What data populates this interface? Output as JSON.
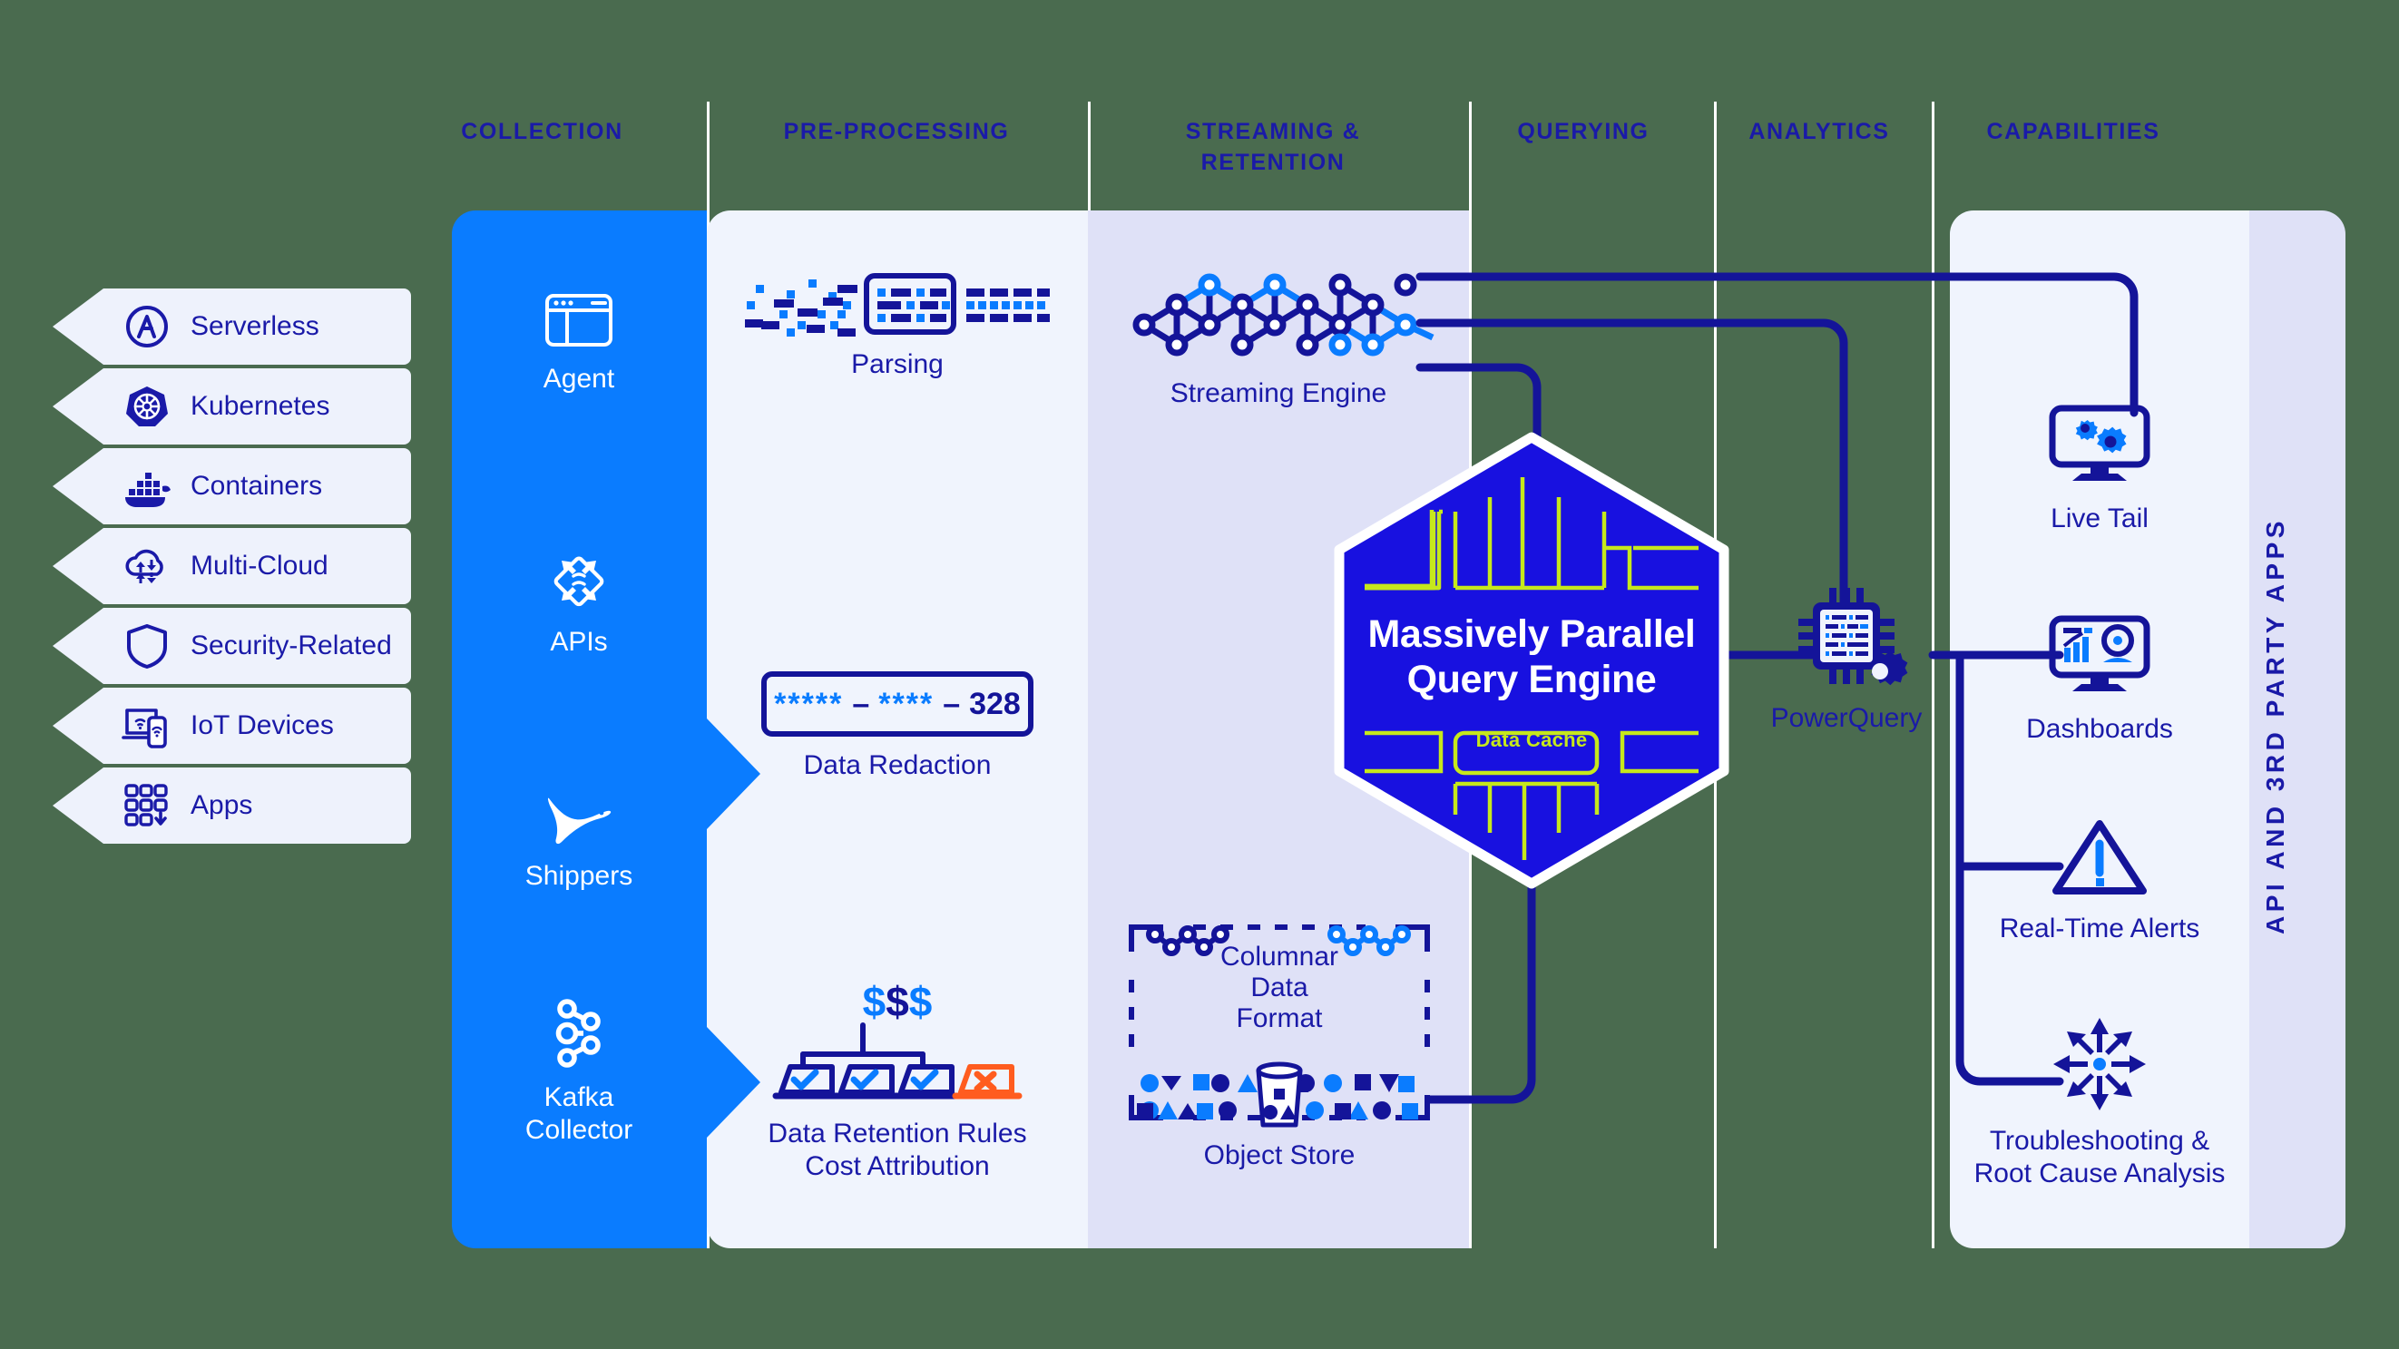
{
  "columns": [
    {
      "id": "collection",
      "label": "COLLECTION"
    },
    {
      "id": "pre-processing",
      "label": "PRE-PROCESSING"
    },
    {
      "id": "streaming-retention",
      "label": "STREAMING &\nRETENTION"
    },
    {
      "id": "querying",
      "label": "QUERYING"
    },
    {
      "id": "analytics",
      "label": "ANALYTICS"
    },
    {
      "id": "capabilities",
      "label": "CAPABILITIES"
    }
  ],
  "sources": [
    {
      "label": "Serverless",
      "icon": "lambda-icon"
    },
    {
      "label": "Kubernetes",
      "icon": "kubernetes-icon"
    },
    {
      "label": "Containers",
      "icon": "docker-icon"
    },
    {
      "label": "Multi-Cloud",
      "icon": "cloud-icon"
    },
    {
      "label": "Security-Related",
      "icon": "shield-icon"
    },
    {
      "label": "IoT Devices",
      "icon": "iot-devices-icon"
    },
    {
      "label": "Apps",
      "icon": "apps-grid-icon"
    }
  ],
  "collection": [
    {
      "label": "Agent",
      "icon": "browser-window-icon"
    },
    {
      "label": "APIs",
      "icon": "api-diamond-icon"
    },
    {
      "label": "Shippers",
      "icon": "bird-icon"
    },
    {
      "label": "Kafka\nCollector",
      "icon": "kafka-icon"
    }
  ],
  "preprocessing": [
    {
      "label": "Parsing",
      "icon": "parsing-icon"
    },
    {
      "label": "Data Redaction",
      "icon": "redaction-icon",
      "redacted_value": "***** – **** – 328",
      "redacted_masked": "*****",
      "redacted_masked2": "****",
      "redacted_clear": "328",
      "dash": "–"
    },
    {
      "label": "Data Retention Rules\nCost Attribution",
      "icon": "retention-cost-icon",
      "money": "$$$"
    }
  ],
  "streaming": [
    {
      "label": "Streaming Engine",
      "icon": "network-lattice-icon"
    },
    {
      "label": "Columnar\nData\nFormat",
      "icon": "columnar-format-icon"
    },
    {
      "label": "Object Store",
      "icon": "object-store-icon"
    }
  ],
  "querying": {
    "title": "Massively Parallel\nQuery Engine",
    "cache_label": "Data Cache",
    "icon": "hexagon-query-engine"
  },
  "analytics": [
    {
      "label": "PowerQuery",
      "icon": "chip-gear-icon"
    }
  ],
  "capabilities": [
    {
      "label": "Live Tail",
      "icon": "monitor-gears-icon"
    },
    {
      "label": "Dashboards",
      "icon": "monitor-chart-icon"
    },
    {
      "label": "Real-Time Alerts",
      "icon": "warning-triangle-icon"
    },
    {
      "label": "Troubleshooting &\nRoot Cause Analysis",
      "icon": "root-cause-burst-icon"
    }
  ],
  "api_panel": {
    "label": "API AND 3RD PARTY APPS"
  },
  "colors": {
    "navy": "#1a1aa8",
    "bright_blue": "#0a7cff",
    "royal": "#1811e0",
    "lime": "#c6e81c",
    "orange": "#ff5c1f",
    "band_light": "#f0f4fd",
    "band_lavender": "#dfe1f7",
    "collection_blue": "#0a7cff",
    "tag_bg": "#eef2fc",
    "page_bg": "#4a6b4f"
  }
}
